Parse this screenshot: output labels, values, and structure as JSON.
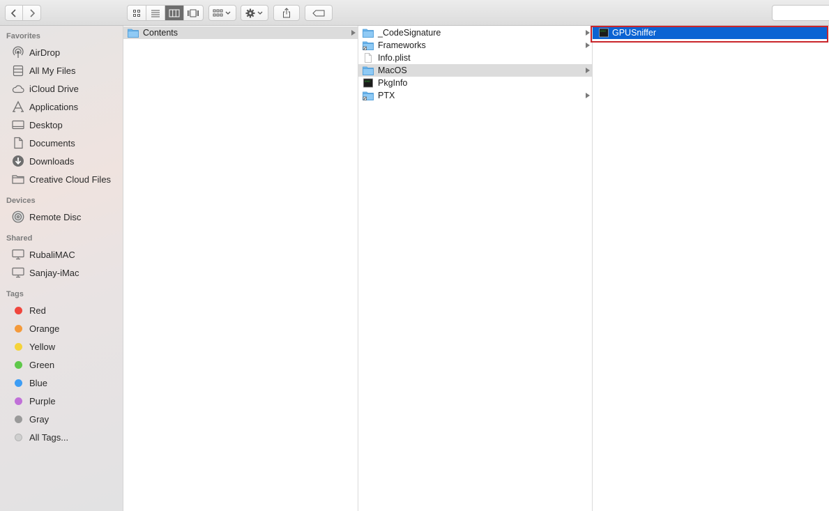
{
  "toolbar": {
    "back": "back-icon",
    "forward": "forward-icon",
    "views": [
      "icon-view",
      "list-view",
      "column-view",
      "gallery-view"
    ],
    "active_view": "column-view"
  },
  "sidebar": {
    "favorites_header": "Favorites",
    "favorites": [
      {
        "label": "AirDrop",
        "icon": "airdrop-icon"
      },
      {
        "label": "All My Files",
        "icon": "all-files-icon"
      },
      {
        "label": "iCloud Drive",
        "icon": "cloud-icon"
      },
      {
        "label": "Applications",
        "icon": "applications-icon"
      },
      {
        "label": "Desktop",
        "icon": "desktop-icon"
      },
      {
        "label": "Documents",
        "icon": "documents-icon"
      },
      {
        "label": "Downloads",
        "icon": "downloads-icon"
      },
      {
        "label": "Creative Cloud Files",
        "icon": "folder-icon"
      }
    ],
    "devices_header": "Devices",
    "devices": [
      {
        "label": "Remote Disc",
        "icon": "disc-icon"
      }
    ],
    "shared_header": "Shared",
    "shared": [
      {
        "label": "RubaliMAC",
        "icon": "computer-icon"
      },
      {
        "label": "Sanjay-iMac",
        "icon": "computer-icon"
      }
    ],
    "tags_header": "Tags",
    "tags": [
      {
        "label": "Red",
        "color": "#f0463d"
      },
      {
        "label": "Orange",
        "color": "#f49a3b"
      },
      {
        "label": "Yellow",
        "color": "#f5d33a"
      },
      {
        "label": "Green",
        "color": "#5fc84a"
      },
      {
        "label": "Blue",
        "color": "#3d9df4"
      },
      {
        "label": "Purple",
        "color": "#c070d8"
      },
      {
        "label": "Gray",
        "color": "#9a9a9a"
      },
      {
        "label": "All Tags...",
        "color": "#cfcfcf"
      }
    ]
  },
  "columns": {
    "col1": [
      {
        "name": "Contents",
        "type": "folder",
        "expandable": true
      }
    ],
    "col2": [
      {
        "name": "_CodeSignature",
        "type": "folder",
        "expandable": true
      },
      {
        "name": "Frameworks",
        "type": "folder-alias",
        "expandable": true
      },
      {
        "name": "Info.plist",
        "type": "file",
        "expandable": false
      },
      {
        "name": "MacOS",
        "type": "folder",
        "expandable": true
      },
      {
        "name": "PkgInfo",
        "type": "exec",
        "expandable": false
      },
      {
        "name": "PTX",
        "type": "folder-alias",
        "expandable": true
      }
    ],
    "col3": [
      {
        "name": "GPUSniffer",
        "type": "exec",
        "expandable": false
      }
    ]
  },
  "selection_color": "#0b63d3",
  "highlight_color": "#c9252b"
}
